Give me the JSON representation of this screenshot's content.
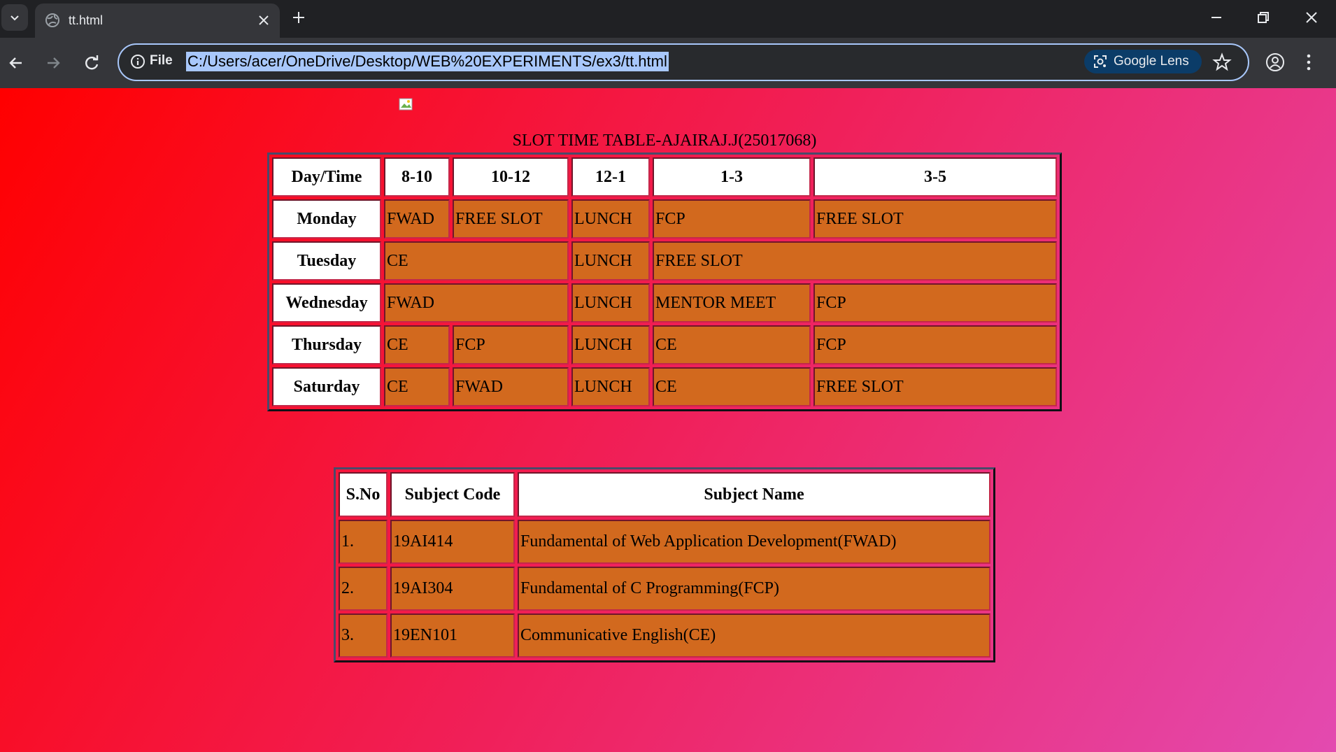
{
  "browser": {
    "tab_title": "tt.html",
    "url_scheme_label": "File",
    "url": "C:/Users/acer/OneDrive/Desktop/WEB%20EXPERIMENTS/ex3/tt.html",
    "lens_label": "Google Lens"
  },
  "page": {
    "caption": "SLOT TIME TABLE-AJAIRAJ.J(25017068)",
    "timetable": {
      "headers": [
        "Day/Time",
        "8-10",
        "10-12",
        "12-1",
        "1-3",
        "3-5"
      ],
      "rows": [
        {
          "day": "Monday",
          "cells": [
            "FWAD",
            "FREE SLOT",
            "LUNCH",
            "FCP",
            "FREE SLOT"
          ]
        },
        {
          "day": "Tuesday",
          "cells": [
            "CE",
            "LUNCH",
            "FREE SLOT"
          ]
        },
        {
          "day": "Wednesday",
          "cells": [
            "FWAD",
            "LUNCH",
            "MENTOR MEET",
            "FCP"
          ]
        },
        {
          "day": "Thursday",
          "cells": [
            "CE",
            "FCP",
            "LUNCH",
            "CE",
            "FCP"
          ]
        },
        {
          "day": "Saturday",
          "cells": [
            "CE",
            "FWAD",
            "LUNCH",
            "CE",
            "FREE SLOT"
          ]
        }
      ]
    },
    "subjects": {
      "headers": [
        "S.No",
        "Subject Code",
        "Subject Name"
      ],
      "rows": [
        {
          "sno": "1.",
          "code": "19AI414",
          "name": "Fundamental of Web Application Development(FWAD)"
        },
        {
          "sno": "2.",
          "code": "19AI304",
          "name": "Fundamental of C Programming(FCP)"
        },
        {
          "sno": "3.",
          "code": "19EN101",
          "name": "Communicative English(CE)"
        }
      ]
    }
  },
  "colors": {
    "cell_bg": "#d2691e",
    "header_bg": "#ffffff",
    "gradient_start": "#ff0000",
    "gradient_end": "#e34ab0"
  }
}
